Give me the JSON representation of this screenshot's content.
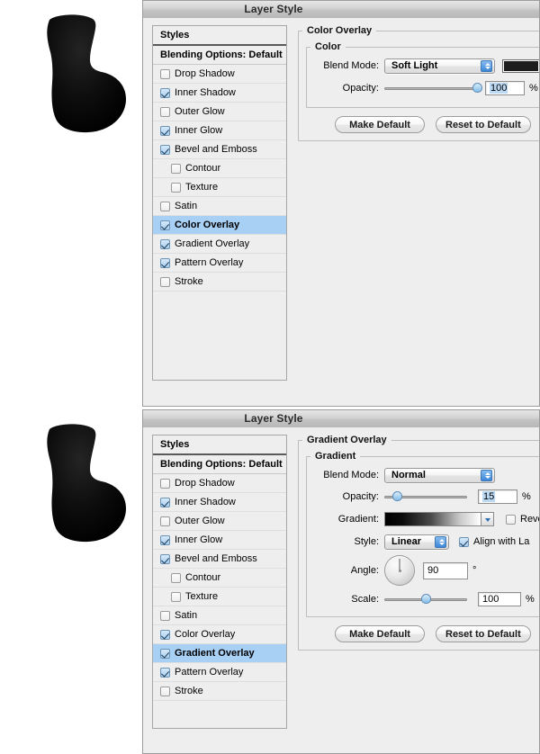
{
  "window": {
    "title": "Layer Style"
  },
  "styles_panel": {
    "header": "Styles",
    "blending_options": "Blending Options: Default",
    "items": [
      {
        "label": "Drop Shadow",
        "checked": false,
        "indent": false
      },
      {
        "label": "Inner Shadow",
        "checked": true,
        "indent": false
      },
      {
        "label": "Outer Glow",
        "checked": false,
        "indent": false
      },
      {
        "label": "Inner Glow",
        "checked": true,
        "indent": false
      },
      {
        "label": "Bevel and Emboss",
        "checked": true,
        "indent": false
      },
      {
        "label": "Contour",
        "checked": false,
        "indent": true
      },
      {
        "label": "Texture",
        "checked": false,
        "indent": true
      },
      {
        "label": "Satin",
        "checked": false,
        "indent": false
      },
      {
        "label": "Color Overlay",
        "checked": true,
        "indent": false
      },
      {
        "label": "Gradient Overlay",
        "checked": true,
        "indent": false
      },
      {
        "label": "Pattern Overlay",
        "checked": true,
        "indent": false
      },
      {
        "label": "Stroke",
        "checked": false,
        "indent": false
      }
    ]
  },
  "dialog_one": {
    "selected_style": "Color Overlay",
    "section_title": "Color Overlay",
    "group_title": "Color",
    "blend_mode_label": "Blend Mode:",
    "blend_mode_value": "Soft Light",
    "color_swatch": "#1e1e1e",
    "opacity_label": "Opacity:",
    "opacity_value": "100",
    "opacity_unit": "%",
    "opacity_percent": 100,
    "make_default": "Make Default",
    "reset_to_default": "Reset to Default"
  },
  "dialog_two": {
    "selected_style": "Gradient Overlay",
    "section_title": "Gradient Overlay",
    "group_title": "Gradient",
    "blend_mode_label": "Blend Mode:",
    "blend_mode_value": "Normal",
    "opacity_label": "Opacity:",
    "opacity_value": "15",
    "opacity_unit": "%",
    "opacity_percent": 15,
    "gradient_label": "Gradient:",
    "reverse_label": "Revers",
    "reverse_checked": false,
    "style_label": "Style:",
    "style_value": "Linear",
    "align_label": "Align with La",
    "align_checked": true,
    "angle_label": "Angle:",
    "angle_value": "90",
    "angle_unit": "°",
    "scale_label": "Scale:",
    "scale_value": "100",
    "scale_unit": "%",
    "scale_percent": 100,
    "make_default": "Make Default",
    "reset_to_default": "Reset to Default"
  },
  "artwork": {
    "shape_one_name": "black-boot-shape",
    "shape_two_name": "black-boot-shape"
  }
}
